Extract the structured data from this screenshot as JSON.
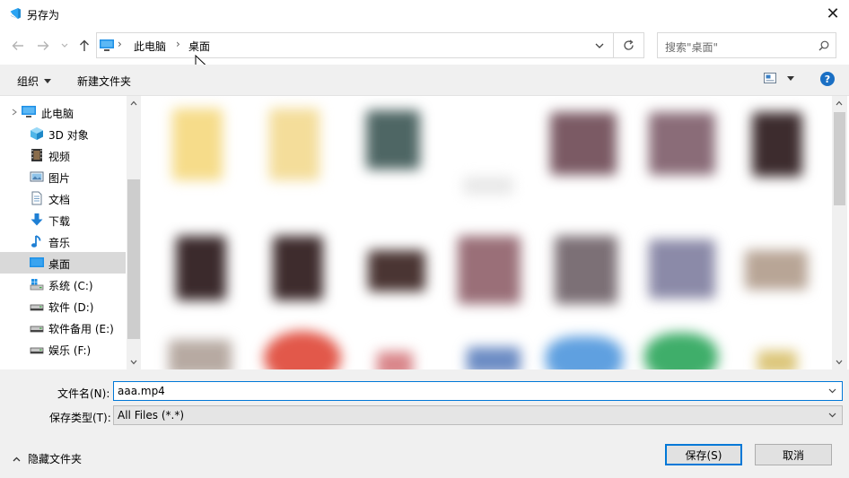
{
  "window": {
    "title": "另存为",
    "close_glyph": "✕"
  },
  "address": {
    "crumbs": [
      "此电脑",
      "桌面"
    ],
    "separator": "›"
  },
  "search": {
    "placeholder": "搜索\"桌面\""
  },
  "toolbar": {
    "organize_label": "组织",
    "new_folder_label": "新建文件夹",
    "help_glyph": "?"
  },
  "nav": {
    "items": [
      {
        "label": "此电脑",
        "icon": "computer-icon"
      },
      {
        "label": "3D 对象",
        "icon": "3d-objects-icon"
      },
      {
        "label": "视频",
        "icon": "video-icon"
      },
      {
        "label": "图片",
        "icon": "picture-icon"
      },
      {
        "label": "文档",
        "icon": "document-icon"
      },
      {
        "label": "下载",
        "icon": "download-icon"
      },
      {
        "label": "音乐",
        "icon": "music-icon"
      },
      {
        "label": "桌面",
        "icon": "desktop-icon",
        "selected": true
      },
      {
        "label": "系统 (C:)",
        "icon": "system-drive-icon"
      },
      {
        "label": "软件 (D:)",
        "icon": "drive-icon"
      },
      {
        "label": "软件备用 (E:)",
        "icon": "drive-icon"
      },
      {
        "label": "娱乐 (F:)",
        "icon": "drive-icon"
      }
    ]
  },
  "form": {
    "filename_label": "文件名(N):",
    "filename_value": "aaa.mp4",
    "filetype_label": "保存类型(T):",
    "filetype_value": "All Files (*.*)"
  },
  "footer": {
    "hide_folders_label": "隐藏文件夹",
    "save_label": "保存(S)",
    "cancel_label": "取消"
  },
  "colors": {
    "accent": "#0078d7",
    "selected_bg": "#d9d9d9",
    "chrome_bg": "#f0f0f0"
  }
}
